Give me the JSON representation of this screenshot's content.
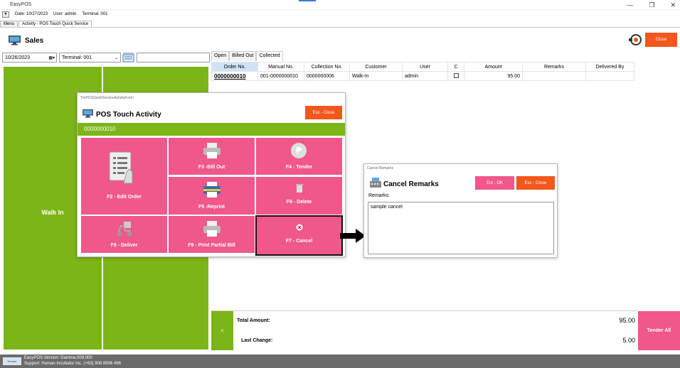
{
  "window": {
    "title": "EasyPOS"
  },
  "infobar": {
    "date": "Date: 10/27/2023",
    "user": "User: admin",
    "terminal": "Terminal: 001"
  },
  "tabs": [
    {
      "label": "Menu"
    },
    {
      "label": "Activity - POS Touch Quick Service"
    }
  ],
  "header": {
    "title": "Sales",
    "close_label": "Close"
  },
  "filters": {
    "date": "10/26/2023",
    "terminal": "Terminal: 001",
    "search": ""
  },
  "left_panel": {
    "walk_in_label": "Walk In"
  },
  "order_tabs": [
    {
      "label": "Open"
    },
    {
      "label": "Billed Out"
    },
    {
      "label": "Collected"
    }
  ],
  "table": {
    "columns": [
      "Order No.",
      "Manual No.",
      "Collection No.",
      "Customer",
      "User",
      "C",
      "Amount",
      "Remarks",
      "Delivered By"
    ],
    "rows": [
      {
        "order_no": "0000000010",
        "manual_no": "001-0000000010",
        "collection_no": "0000000006",
        "customer": "Walk-In",
        "user": "admin",
        "amount": "95.00",
        "remarks": "",
        "delivered_by": ""
      }
    ]
  },
  "footer": {
    "back_label": "<",
    "total_label": "Total Amount:",
    "total_value": "95.00",
    "change_label": "Last Change:",
    "change_value": "5.00",
    "tender_all_label": "Tender All"
  },
  "status": {
    "logo_text": "Human Incubator",
    "version": "EasyPOS Version: Gamma.009.000",
    "support": "Support: Human Incubator Inc. (+63) 908 8906 496"
  },
  "activity_dialog": {
    "form_name": "TrnPOSQuickServiceActivityForm",
    "title": "POS Touch Activity",
    "close_label": "Esc - Close",
    "order_number": "0000000010",
    "buttons": {
      "edit_order": "F2 - Edit Order",
      "bill_out": "F3 -Bill Out",
      "tender": "F4 - Tender",
      "reprint": "F5 -Reprint",
      "delete": "F6 - Delete",
      "deliver": "F8 - Deliver",
      "print_partial": "F9 - Print Partial Bill",
      "cancel": "F7 - Cancel"
    }
  },
  "remarks_dialog": {
    "form_name": "Cancel Remarks",
    "title": "Cancel Remarks",
    "ok_label": "Ent - OK",
    "close_label": "Esc - Close",
    "remarks_label": "Remarks:",
    "remarks_value": "sample cancel"
  },
  "colors": {
    "green": "#7cb518",
    "pink": "#f0578a",
    "orange": "#f2571c"
  }
}
